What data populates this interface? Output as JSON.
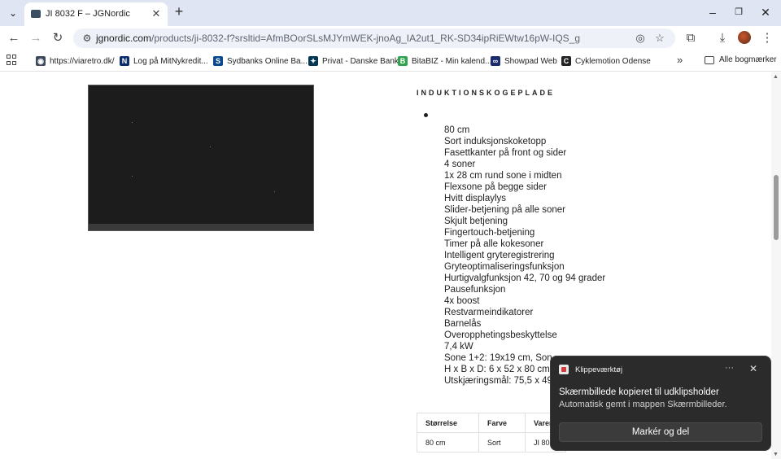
{
  "browser": {
    "tab_title": "JI 8032 F – JGNordic",
    "url_host": "jgnordic.com",
    "url_path": "/products/ji-8032-f?srsltid=AfmBOorSLsMJYmWEK-jnoAg_IA2ut1_RK-SD34ipRiEWtw16pW-IQS_g"
  },
  "bookmarks": [
    {
      "label": "https://viaretro.dk/",
      "icon": "viaretro-icon",
      "color": "#3d4a5c",
      "glyph": "◉"
    },
    {
      "label": "Log på MitNykredit...",
      "icon": "nykredit-icon",
      "color": "#0a2d6b",
      "glyph": "N"
    },
    {
      "label": "Sydbanks Online Ba...",
      "icon": "sydbank-icon",
      "color": "#0b4a8f",
      "glyph": "S"
    },
    {
      "label": "Privat - Danske Bank",
      "icon": "danske-bank-icon",
      "color": "#003755",
      "glyph": "✦"
    },
    {
      "label": "BitaBIZ - Min kalend...",
      "icon": "bitabiz-icon",
      "color": "#2fa44f",
      "glyph": "B"
    },
    {
      "label": "Showpad Web",
      "icon": "showpad-icon",
      "color": "#1c2a6e",
      "glyph": "∞"
    },
    {
      "label": "Cyklemotion Odense",
      "icon": "cyklemotion-icon",
      "color": "#222222",
      "glyph": "C"
    }
  ],
  "bookmarks_folder": "Alle bogmærker",
  "page": {
    "section_heading": "INDUKTIONSKOGEPLADE",
    "features": [
      "80 cm",
      "Sort induksjonskoketopp",
      "Fasettkanter på front og sider",
      "4 soner",
      "1x 28 cm rund sone i midten",
      "Flexsone på begge sider",
      "Hvitt displaylys",
      "Slider-betjening på alle soner",
      "Skjult betjening",
      "Fingertouch-betjening",
      "Timer på alle kokesoner",
      "Intelligent gryteregistrering",
      "Gryteoptimaliseringsfunksjon",
      "Hurtigvalgfunksjon 42, 70 og 94 grader",
      "Pausefunksjon",
      "4x boost",
      "Restvarmeindikatorer",
      "Barnelås",
      "Overopphetingsbeskyttelse",
      "7,4 kW",
      "Sone 1+2: 19x19 cm, Son",
      "H x B x D: 6 x 52 x 80 cm",
      "Utskjæringsmål: 75,5 x 49"
    ],
    "table": {
      "headers": [
        "Størrelse",
        "Farve",
        "Varer"
      ],
      "row": [
        "80 cm",
        "Sort",
        "JI 803"
      ]
    }
  },
  "toast": {
    "app_name": "Klippeværktøj",
    "more": "···",
    "close": "✕",
    "title": "Skærmbillede kopieret til udklipsholder",
    "body": "Automatisk gemt i mappen Skærmbilleder.",
    "action": "Markér og del"
  }
}
